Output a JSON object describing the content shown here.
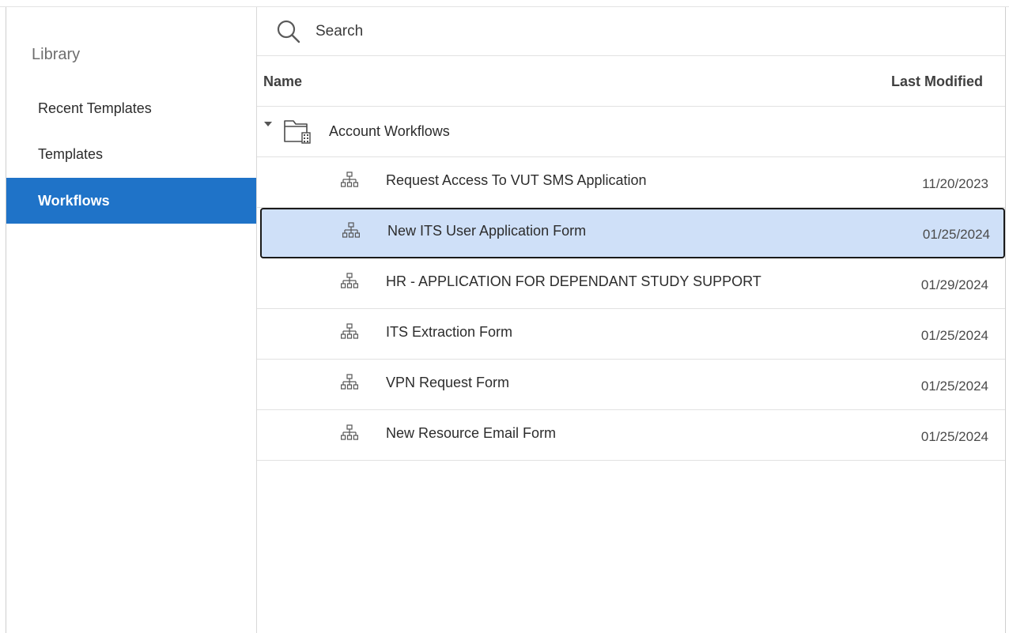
{
  "sidebar": {
    "heading": "Library",
    "items": [
      {
        "label": "Recent Templates"
      },
      {
        "label": "Templates"
      },
      {
        "label": "Workflows",
        "active": true
      }
    ]
  },
  "search": {
    "placeholder": "Search",
    "icon": "search-icon"
  },
  "table": {
    "columns": {
      "name": "Name",
      "modified": "Last Modified"
    },
    "folder": {
      "label": "Account Workflows",
      "icon": "folder-icon",
      "expanded": true
    },
    "rows": [
      {
        "name": "Request Access To VUT SMS Application",
        "date": "11/20/2023"
      },
      {
        "name": "New ITS User Application Form",
        "date": "01/25/2024",
        "selected": true
      },
      {
        "name": "HR - APPLICATION FOR DEPENDANT STUDY SUPPORT",
        "date": "01/29/2024"
      },
      {
        "name": "ITS Extraction Form",
        "date": "01/25/2024"
      },
      {
        "name": "VPN Request Form",
        "date": "01/25/2024"
      },
      {
        "name": "New Resource Email Form",
        "date": "01/25/2024"
      }
    ]
  },
  "colors": {
    "accent": "#1f73c8",
    "selected_row": "#cfe0f8"
  }
}
